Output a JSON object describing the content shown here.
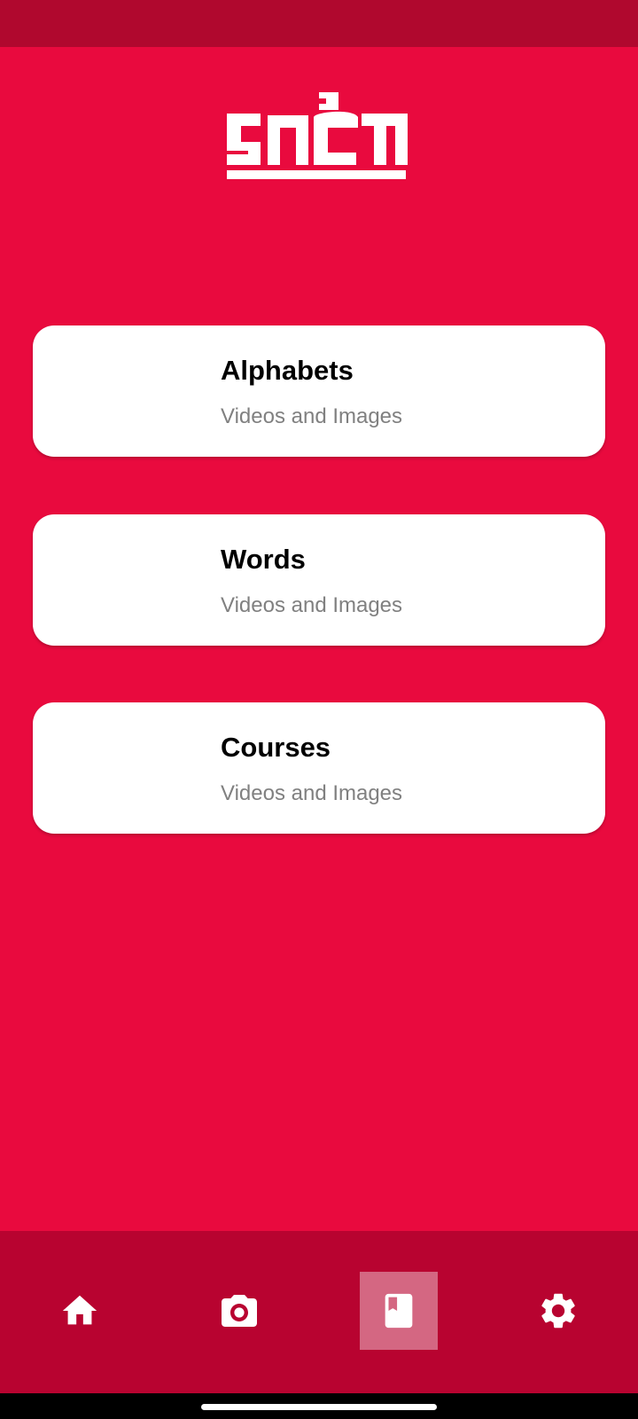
{
  "app": {
    "logo_icon": "app-logo"
  },
  "cards": [
    {
      "title": "Alphabets",
      "subtitle": "Videos and Images"
    },
    {
      "title": "Words",
      "subtitle": "Videos and Images"
    },
    {
      "title": "Courses",
      "subtitle": "Videos and Images"
    }
  ],
  "bottom_nav": {
    "items": [
      {
        "icon": "home-icon",
        "selected": false
      },
      {
        "icon": "camera-icon",
        "selected": false
      },
      {
        "icon": "book-icon",
        "selected": true
      },
      {
        "icon": "gear-icon",
        "selected": false
      }
    ]
  },
  "colors": {
    "background": "#E90A3E",
    "status_bar": "#B0082E",
    "nav_bar": "#B80330",
    "card": "#FFFFFF",
    "title_text": "#000000",
    "subtitle_text": "#808080"
  }
}
